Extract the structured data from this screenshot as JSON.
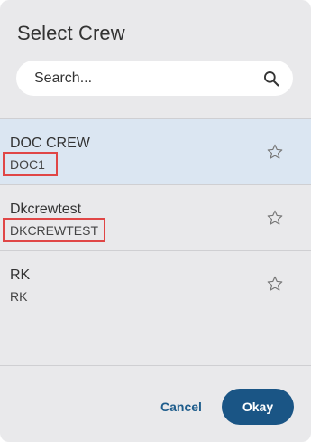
{
  "dialog": {
    "title": "Select Crew"
  },
  "search": {
    "placeholder": "Search...",
    "icon": "search-icon"
  },
  "crews": [
    {
      "name": "DOC CREW",
      "code": "DOC1",
      "selected": true,
      "favorite": false
    },
    {
      "name": "Dkcrewtest",
      "code": "DKCREWTEST",
      "selected": false,
      "favorite": false
    },
    {
      "name": "RK",
      "code": "RK",
      "selected": false,
      "favorite": false
    }
  ],
  "buttons": {
    "cancel": "Cancel",
    "okay": "Okay"
  },
  "colors": {
    "dialog_bg": "#e9e9eb",
    "selected_row": "#dbe6f2",
    "primary": "#1a5585",
    "highlight": "#e04646"
  }
}
